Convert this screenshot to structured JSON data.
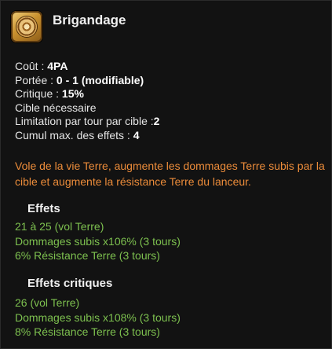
{
  "spell": {
    "name": "Brigandage",
    "icon": "spell-icon-brigandage"
  },
  "stats": [
    {
      "label": "Coût :",
      "value": "4PA"
    },
    {
      "label": "Portée :",
      "value": "0 - 1 (modifiable)"
    },
    {
      "label": "Critique :",
      "value": "15%"
    },
    {
      "label": "Cible nécessaire",
      "value": ""
    },
    {
      "label": "Limitation par tour par cible :",
      "value": "2"
    },
    {
      "label": "Cumul max. des effets :",
      "value": "4"
    }
  ],
  "description": "Vole de la vie Terre, augmente les dommages Terre subis par la cible et augmente la résistance Terre du lanceur.",
  "effects": {
    "title": "Effets",
    "lines": [
      "21 à 25 (vol Terre)",
      "Dommages subis x106% (3 tours)",
      "6% Résistance Terre (3 tours)"
    ]
  },
  "critical_effects": {
    "title": "Effets critiques",
    "lines": [
      "26 (vol Terre)",
      "Dommages subis x108% (3 tours)",
      "8% Résistance Terre (3 tours)"
    ]
  },
  "colors": {
    "description": "#ec8c3a",
    "effect_text": "#7dc04f"
  }
}
